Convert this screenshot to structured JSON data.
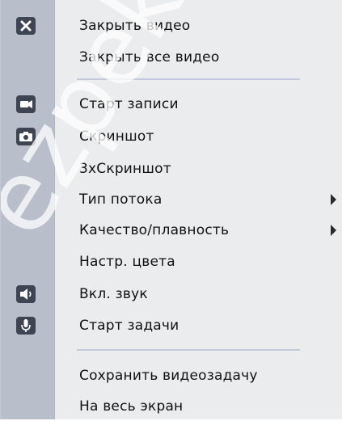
{
  "menu": {
    "items": [
      {
        "label": "Закрыть видео",
        "icon": "close-icon"
      },
      {
        "label": "Закрыть все видео"
      },
      {
        "label": "Старт записи",
        "icon": "record-camera-icon"
      },
      {
        "label": "Скриншот",
        "icon": "screenshot-camera-icon"
      },
      {
        "label": "3хСкриншот"
      },
      {
        "label": "Тип потока",
        "submenu": true
      },
      {
        "label": "Качество/плавность",
        "submenu": true
      },
      {
        "label": "Настр. цвета"
      },
      {
        "label": "Вкл. звук",
        "icon": "speaker-icon"
      },
      {
        "label": "Старт задачи",
        "icon": "microphone-icon"
      },
      {
        "label": "Сохранить видеозадачу"
      },
      {
        "label": "На весь экран"
      }
    ]
  },
  "watermark": {
    "text": "ezpek"
  },
  "colors": {
    "background": "#ebecee",
    "icon_strip": "#b8bfcb",
    "icon_bg": "#3d4452",
    "separator": "#c3cbda",
    "text": "#111111"
  }
}
